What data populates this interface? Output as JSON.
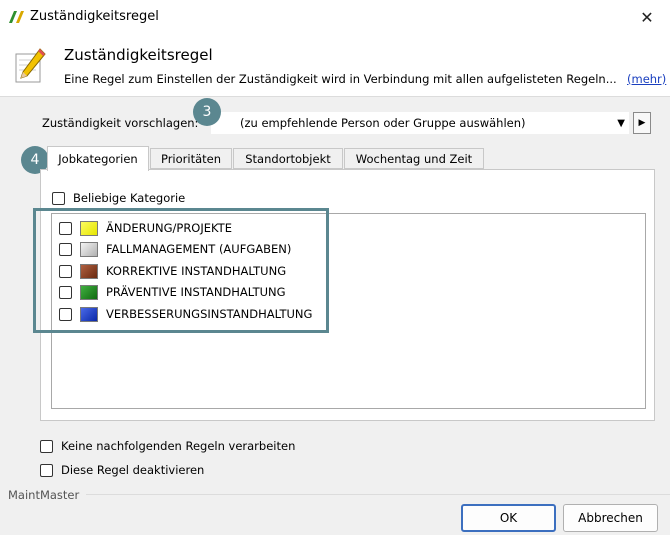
{
  "window": {
    "title": "Zuständigkeitsregel"
  },
  "header": {
    "title": "Zuständigkeitsregel",
    "description": "Eine Regel zum Einstellen der Zuständigkeit wird in Verbindung mit allen aufgelisteten Regeln...",
    "more_link": "(mehr)"
  },
  "suggest": {
    "label": "Zuständigkeit vorschlagen:",
    "value": "(zu empfehlende Person oder Gruppe auswählen)"
  },
  "badges": {
    "step3": "3",
    "step4": "4"
  },
  "tabs": [
    {
      "label": "Jobkategorien",
      "active": true
    },
    {
      "label": "Prioritäten",
      "active": false
    },
    {
      "label": "Standortobjekt",
      "active": false
    },
    {
      "label": "Wochentag und Zeit",
      "active": false
    }
  ],
  "any_category": {
    "label": "Beliebige Kategorie",
    "checked": false
  },
  "categories": [
    {
      "label": "ÄNDERUNG/PROJEKTE",
      "color": "#f2f200",
      "checked": false
    },
    {
      "label": "FALLMANAGEMENT (AUFGABEN)",
      "color": "#c8c8c8",
      "checked": false
    },
    {
      "label": "KORREKTIVE INSTANDHALTUNG",
      "color": "#8b3a1a",
      "checked": false
    },
    {
      "label": "PRÄVENTIVE INSTANDHALTUNG",
      "color": "#1e8c1e",
      "checked": false
    },
    {
      "label": "VERBESSERUNGSINSTANDHALTUNG",
      "color": "#1a3fcc",
      "checked": false
    }
  ],
  "options": {
    "no_following": {
      "label": "Keine nachfolgenden Regeln verarbeiten",
      "checked": false
    },
    "deactivate": {
      "label": "Diese Regel deaktivieren",
      "checked": false
    }
  },
  "footer": {
    "brand": "MaintMaster",
    "ok_label": "OK",
    "cancel_label": "Abbrechen"
  },
  "colors": {
    "accent": "#5b8790",
    "link": "#1a3fbf"
  }
}
